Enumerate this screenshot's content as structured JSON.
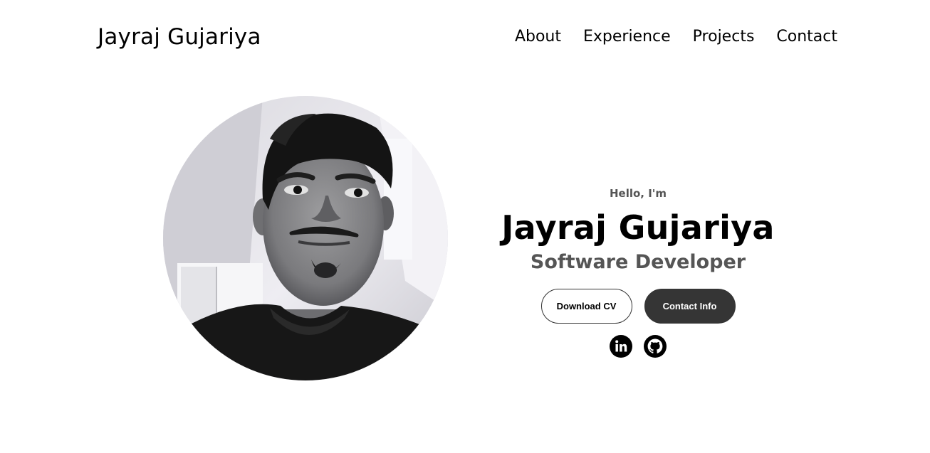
{
  "nav": {
    "logo": "Jayraj Gujariya",
    "links": [
      {
        "label": "About"
      },
      {
        "label": "Experience"
      },
      {
        "label": "Projects"
      },
      {
        "label": "Contact"
      }
    ]
  },
  "hero": {
    "greeting": "Hello, I'm",
    "name": "Jayraj Gujariya",
    "title": "Software Developer",
    "buttons": {
      "download_cv": "Download CV",
      "contact_info": "Contact Info"
    },
    "socials": [
      {
        "icon": "linkedin-icon"
      },
      {
        "icon": "github-icon"
      }
    ],
    "profile_image_alt": "Jayraj Gujariya profile picture"
  },
  "colors": {
    "text_primary": "#000000",
    "text_secondary": "#555555",
    "button_dark": "#353535",
    "background": "#ffffff"
  }
}
